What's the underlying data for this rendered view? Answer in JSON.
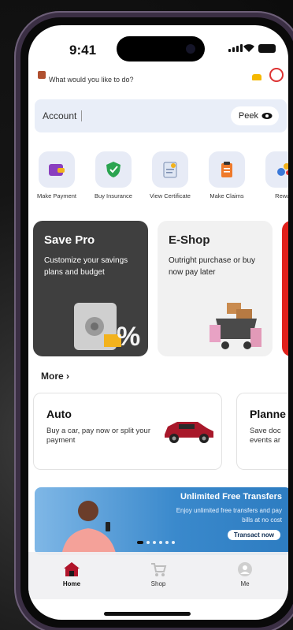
{
  "status": {
    "time": "9:41"
  },
  "header": {
    "greeting": "What would you like to do?"
  },
  "account": {
    "label": "Account",
    "peek_label": "Peek"
  },
  "quick_actions": [
    {
      "label": "Make Payment",
      "icon": "wallet-icon"
    },
    {
      "label": "Buy Insurance",
      "icon": "shield-icon"
    },
    {
      "label": "View Certificate",
      "icon": "certificate-icon"
    },
    {
      "label": "Make Claims",
      "icon": "clipboard-icon"
    },
    {
      "label": "Rewar",
      "icon": "rewards-icon"
    }
  ],
  "promos": [
    {
      "title": "Save Pro",
      "text": "Customize your savings plans and budget"
    },
    {
      "title": "E-Shop",
      "text": "Outright purchase or buy now pay later"
    }
  ],
  "more": {
    "label": "More"
  },
  "more_cards": [
    {
      "title": "Auto",
      "text": "Buy a car, pay now or split your payment"
    },
    {
      "title": "Planne",
      "text": "Save doc events ar"
    }
  ],
  "banner": {
    "title": "Unlimited Free Transfers",
    "subtitle": "Enjoy unlimited free transfers and pay bills at no cost",
    "button": "Transact now"
  },
  "nav": [
    {
      "label": "Home",
      "active": true
    },
    {
      "label": "Shop",
      "active": false
    },
    {
      "label": "Me",
      "active": false
    }
  ],
  "colors": {
    "accent": "#e0201b",
    "dark_card": "#3f3f3f",
    "banner": "#3a89cc",
    "home_icon": "#b0142a"
  }
}
